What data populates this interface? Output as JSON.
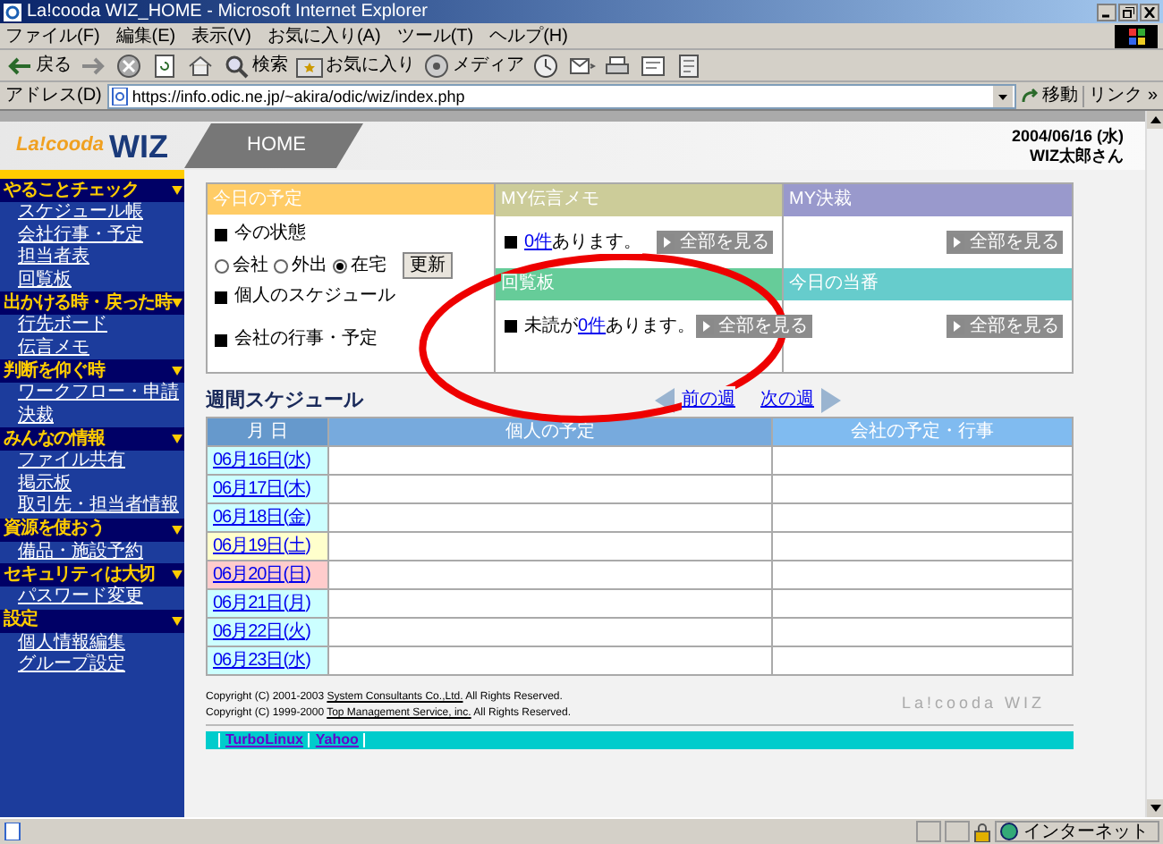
{
  "window": {
    "title": "La!cooda WIZ_HOME - Microsoft Internet Explorer"
  },
  "menu": [
    "ファイル(F)",
    "編集(E)",
    "表示(V)",
    "お気に入り(A)",
    "ツール(T)",
    "ヘルプ(H)"
  ],
  "toolbar": [
    {
      "kind": "back",
      "label": "戻る"
    },
    {
      "kind": "forward"
    },
    {
      "kind": "stop"
    },
    {
      "kind": "refresh"
    },
    {
      "kind": "home"
    },
    {
      "kind": "search",
      "label": "検索"
    },
    {
      "kind": "favorites",
      "label": "お気に入り"
    },
    {
      "kind": "media",
      "label": "メディア"
    },
    {
      "kind": "history"
    },
    {
      "kind": "mail"
    },
    {
      "kind": "print"
    },
    {
      "kind": "edit"
    },
    {
      "kind": "discuss"
    }
  ],
  "address": {
    "label": "アドレス(D)",
    "value": "https://info.odic.ne.jp/~akira/odic/wiz/index.php",
    "go": "移動",
    "links": "リンク",
    "more": "»"
  },
  "header": {
    "logo": "La!cooda",
    "logo_wiz": "WIZ",
    "page": "HOME",
    "date": "2004/06/16 (水)",
    "user": "WIZ太郎さん"
  },
  "sidebar": [
    {
      "title": "やることチェック",
      "items": [
        "スケジュール帳",
        "会社行事・予定",
        "担当者表",
        "回覧板"
      ]
    },
    {
      "title": "出かける時・戻った時",
      "items": [
        "行先ボード",
        "伝言メモ"
      ]
    },
    {
      "title": "判断を仰ぐ時",
      "items": [
        "ワークフロー・申請",
        "決裁"
      ]
    },
    {
      "title": "みんなの情報",
      "items": [
        "ファイル共有",
        "掲示板",
        "取引先・担当者情報"
      ]
    },
    {
      "title": "資源を使おう",
      "items": [
        "備品・施設予約"
      ]
    },
    {
      "title": "セキュリティは大切",
      "items": [
        "パスワード変更"
      ]
    },
    {
      "title": "設定",
      "items": [
        "個人情報編集",
        "グループ設定"
      ]
    }
  ],
  "today": {
    "title": "今日の予定",
    "status_label": "今の状態",
    "options": [
      {
        "label": "会社",
        "selected": false
      },
      {
        "label": "外出",
        "selected": false
      },
      {
        "label": "在宅",
        "selected": true
      }
    ],
    "update": "更新",
    "personal": "個人のスケジュール",
    "company": "会社の行事・予定"
  },
  "panels": [
    {
      "title": "MY伝言メモ",
      "color": "#cccc99",
      "count": "0件",
      "suffix": "あります。",
      "button": "全部を見る"
    },
    {
      "title": "MY決裁",
      "color": "#9999cc",
      "button": "全部を見る"
    },
    {
      "title": "回覧板",
      "color": "#66cc99",
      "prefix": "未読が",
      "count": "0件",
      "suffix": "あります。",
      "button": "全部を見る"
    },
    {
      "title": "今日の当番",
      "color": "#66cccc",
      "button": "全部を見る"
    }
  ],
  "weekly": {
    "title": "週間スケジュール",
    "prev": "前の週",
    "next": "次の週",
    "columns": [
      "月 日",
      "個人の予定",
      "会社の予定・行事"
    ],
    "rows": [
      {
        "date": "06月16日(水)",
        "color": "#ccffff"
      },
      {
        "date": "06月17日(木)",
        "color": "#ccffff"
      },
      {
        "date": "06月18日(金)",
        "color": "#ccffff"
      },
      {
        "date": "06月19日(土)",
        "color": "#ffffcc"
      },
      {
        "date": "06月20日(日)",
        "color": "#ffcccc"
      },
      {
        "date": "06月21日(月)",
        "color": "#ccffff"
      },
      {
        "date": "06月22日(火)",
        "color": "#ccffff"
      },
      {
        "date": "06月23日(水)",
        "color": "#ccffff"
      }
    ]
  },
  "footer": {
    "lines": [
      {
        "before": "Copyright (C) 2001-2003 ",
        "link": "System Consultants Co.,Ltd.",
        "after": " All Rights Reserved."
      },
      {
        "before": "Copyright (C) 1999-2000 ",
        "link": "Top Management Service, inc.",
        "after": " All Rights Reserved."
      }
    ],
    "brand": "La!cooda WIZ",
    "links": [
      "TurboLinux",
      "Yahoo"
    ]
  },
  "status_bar": {
    "zone": "インターネット"
  }
}
